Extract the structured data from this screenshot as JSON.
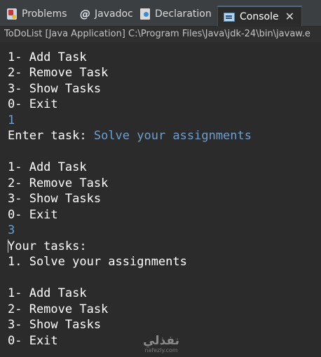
{
  "tabs": [
    {
      "label": "Problems",
      "icon": "problems-icon"
    },
    {
      "label": "Javadoc",
      "icon": "javadoc-icon"
    },
    {
      "label": "Declaration",
      "icon": "declaration-icon"
    },
    {
      "label": "Console",
      "icon": "console-icon",
      "active": true
    }
  ],
  "javadoc_icon_glyph": "@",
  "close_glyph": "✕",
  "launch_description": "ToDoList [Java Application] C:\\Program Files\\Java\\jdk-24\\bin\\javaw.e",
  "console": {
    "menu1": [
      "1- Add Task",
      "2- Remove Task",
      "3- Show Tasks",
      "0- Exit"
    ],
    "input1": "1",
    "enter_prompt": "Enter task: ",
    "task_entered": "Solve your assignments",
    "menu2": [
      "1- Add Task",
      "2- Remove Task",
      "3- Show Tasks",
      "0- Exit"
    ],
    "input2": "3",
    "your_tasks_header": "Your tasks:",
    "task_list": [
      "1. Solve your assignments"
    ],
    "menu3": [
      "1- Add Task",
      "2- Remove Task",
      "3- Show Tasks",
      "0- Exit"
    ]
  },
  "watermark": {
    "logo": "نفذلي",
    "url": "nafezly.com"
  },
  "colors": {
    "background": "#2b2b2b",
    "tabbar": "#3c3f41",
    "output_text": "#ffffff",
    "user_input": "#6f9fd0"
  }
}
